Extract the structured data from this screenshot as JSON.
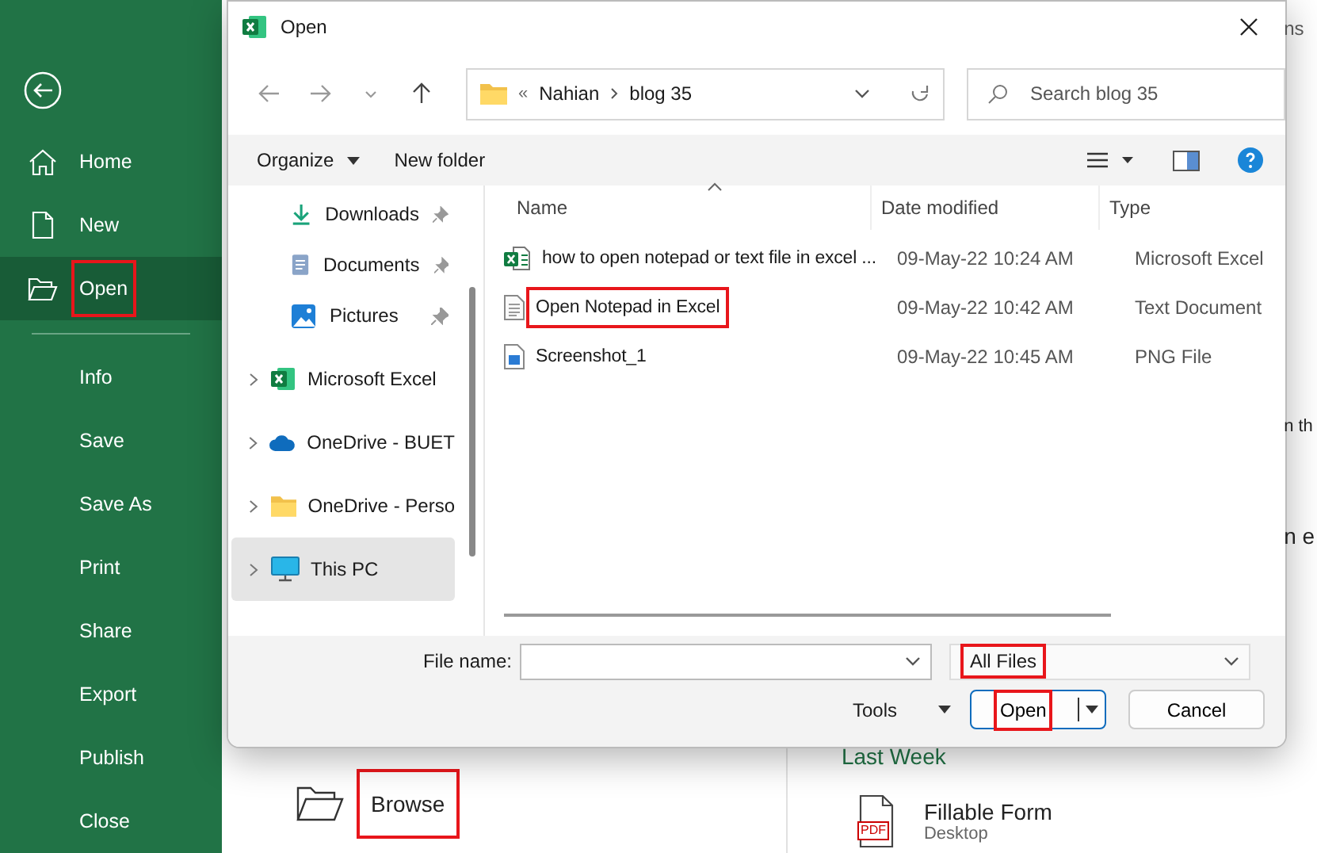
{
  "sidebar": {
    "items": [
      {
        "label": "Home",
        "kind": "home",
        "selected": false,
        "highlighted": false
      },
      {
        "label": "New",
        "kind": "new",
        "selected": false,
        "highlighted": false
      },
      {
        "label": "Open",
        "kind": "open",
        "selected": true,
        "highlighted": true
      },
      {
        "kind": "divider"
      },
      {
        "label": "Info",
        "kind": "plain",
        "selected": false,
        "highlighted": false
      },
      {
        "label": "Save",
        "kind": "plain",
        "selected": false,
        "highlighted": false
      },
      {
        "label": "Save As",
        "kind": "plain",
        "selected": false,
        "highlighted": false
      },
      {
        "label": "Print",
        "kind": "plain",
        "selected": false,
        "highlighted": false
      },
      {
        "label": "Share",
        "kind": "plain",
        "selected": false,
        "highlighted": false
      },
      {
        "label": "Export",
        "kind": "plain",
        "selected": false,
        "highlighted": false
      },
      {
        "label": "Publish",
        "kind": "plain",
        "selected": false,
        "highlighted": false
      },
      {
        "label": "Close",
        "kind": "plain",
        "selected": false,
        "highlighted": false
      }
    ]
  },
  "backstage": {
    "browse": {
      "label": "Browse",
      "highlighted": true
    },
    "section_title": "Last Week",
    "recent": [
      {
        "name": "Fillable Form",
        "location": "Desktop",
        "kind": "pdf",
        "badge": "PDF"
      }
    ],
    "edge_texts": [
      "ns",
      "n th",
      "n e"
    ]
  },
  "dialog": {
    "title": "Open",
    "address": {
      "overflow": "«",
      "path": [
        "Nahian",
        "blog 35"
      ]
    },
    "search": {
      "placeholder": "Search blog 35"
    },
    "toolbar": {
      "organize": "Organize",
      "new_folder": "New folder"
    },
    "nav": [
      {
        "label": "Downloads",
        "kind": "download",
        "pinned": true,
        "collapsed": false,
        "selected": false
      },
      {
        "label": "Documents",
        "kind": "documents",
        "pinned": true,
        "collapsed": false,
        "selected": false
      },
      {
        "label": "Pictures",
        "kind": "pictures",
        "pinned": true,
        "collapsed": false,
        "selected": false
      },
      {
        "label": "Microsoft Excel",
        "kind": "excel",
        "pinned": false,
        "collapsed": true,
        "selected": false
      },
      {
        "label": "OneDrive - BUET",
        "kind": "cloud",
        "pinned": false,
        "collapsed": true,
        "selected": false
      },
      {
        "label": "OneDrive - Perso",
        "kind": "folder",
        "pinned": false,
        "collapsed": true,
        "selected": false
      },
      {
        "label": "This PC",
        "kind": "pc",
        "pinned": false,
        "collapsed": true,
        "selected": true
      }
    ],
    "columns": [
      "Name",
      "Date modified",
      "Type"
    ],
    "files": [
      {
        "name": "how to open notepad or text file in excel ...",
        "date": "09-May-22 10:24 AM",
        "type": "Microsoft Excel",
        "kind": "excel",
        "highlighted": false
      },
      {
        "name": "Open Notepad in Excel",
        "date": "09-May-22 10:42 AM",
        "type": "Text Document",
        "kind": "text",
        "highlighted": true
      },
      {
        "name": "Screenshot_1",
        "date": "09-May-22 10:45 AM",
        "type": "PNG File",
        "kind": "image",
        "highlighted": false
      }
    ],
    "file_name": {
      "label": "File name:"
    },
    "filter": {
      "value": "All Files",
      "highlighted": true
    },
    "tools": "Tools",
    "open_button": {
      "label": "Open",
      "highlighted": true
    },
    "cancel_button": "Cancel"
  }
}
